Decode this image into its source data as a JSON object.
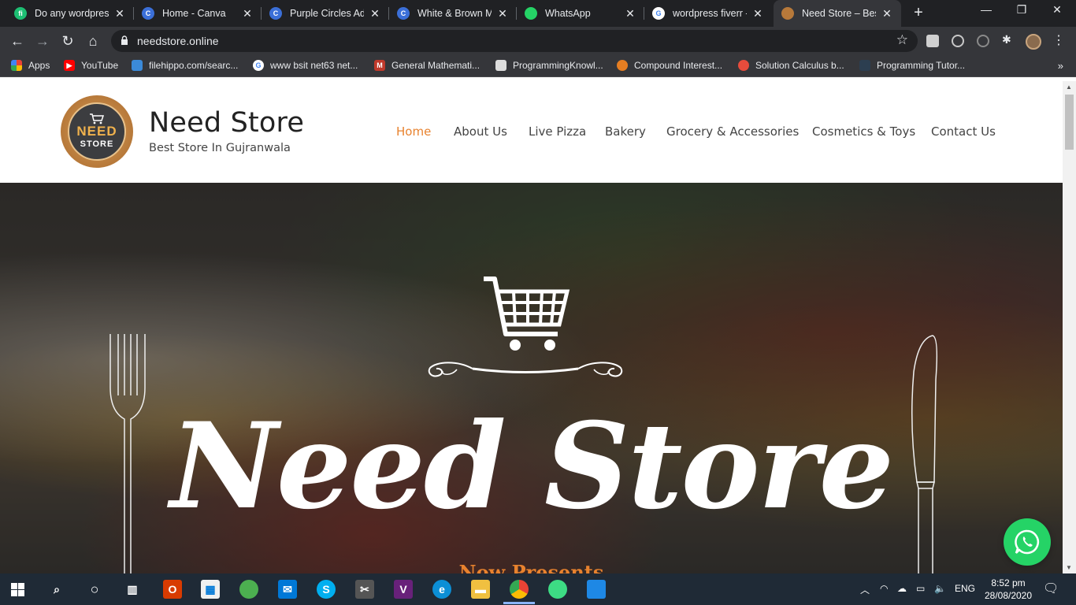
{
  "browser": {
    "tabs": [
      {
        "title": "Do any wordpress",
        "favicon_color": "#1dbf73",
        "favicon_glyph": "fi"
      },
      {
        "title": "Home - Canva",
        "favicon_color": "#3b6fd8",
        "favicon_glyph": "C"
      },
      {
        "title": "Purple Circles Adv",
        "favicon_color": "#3b6fd8",
        "favicon_glyph": "C"
      },
      {
        "title": "White & Brown M",
        "favicon_color": "#3b6fd8",
        "favicon_glyph": "C"
      },
      {
        "title": "WhatsApp",
        "favicon_color": "#25d366",
        "favicon_glyph": ""
      },
      {
        "title": "wordpress fiverr -",
        "favicon_color": "#ffffff",
        "favicon_glyph": "G"
      },
      {
        "title": "Need Store – Best",
        "favicon_color": "#b7793a",
        "favicon_glyph": ""
      }
    ],
    "url": "needstore.online",
    "bookmarks": [
      {
        "label": "Apps",
        "icon": "apps-grid-icon",
        "color": "#ea4335"
      },
      {
        "label": "YouTube",
        "icon": "youtube-icon",
        "color": "#ff0000"
      },
      {
        "label": "filehippo.com/searc...",
        "icon": "filehippo-icon",
        "color": "#3b8ad9"
      },
      {
        "label": "www bsit net63 net...",
        "icon": "google-icon",
        "color": "#ffffff"
      },
      {
        "label": "General Mathemati...",
        "icon": "math-icon",
        "color": "#c0392b"
      },
      {
        "label": "ProgrammingKnowl...",
        "icon": "page-icon",
        "color": "#dddddd"
      },
      {
        "label": "Compound Interest...",
        "icon": "calc-icon",
        "color": "#e67e22"
      },
      {
        "label": "Solution Calculus b...",
        "icon": "target-icon",
        "color": "#e74c3c"
      },
      {
        "label": "Programming Tutor...",
        "icon": "tutor-icon",
        "color": "#2c3e50"
      }
    ],
    "bookmarks_more": "»"
  },
  "site": {
    "logo": {
      "line1": "NEED",
      "line2": "STORE"
    },
    "title": "Need Store",
    "tagline": "Best Store In Gujranwala",
    "nav": [
      "Home",
      "About Us",
      "Live Pizza",
      "Bakery",
      "Grocery & Accessories",
      "Cosmetics & Toys",
      "Contact Us"
    ],
    "nav_active": "Home",
    "accent": "#e8822e",
    "hero": {
      "title": "Need Store",
      "subtitle": "Now Presents"
    },
    "whatsapp_color": "#25d366"
  },
  "taskbar": {
    "language": "ENG",
    "time": "8:52 pm",
    "date": "28/08/2020"
  }
}
